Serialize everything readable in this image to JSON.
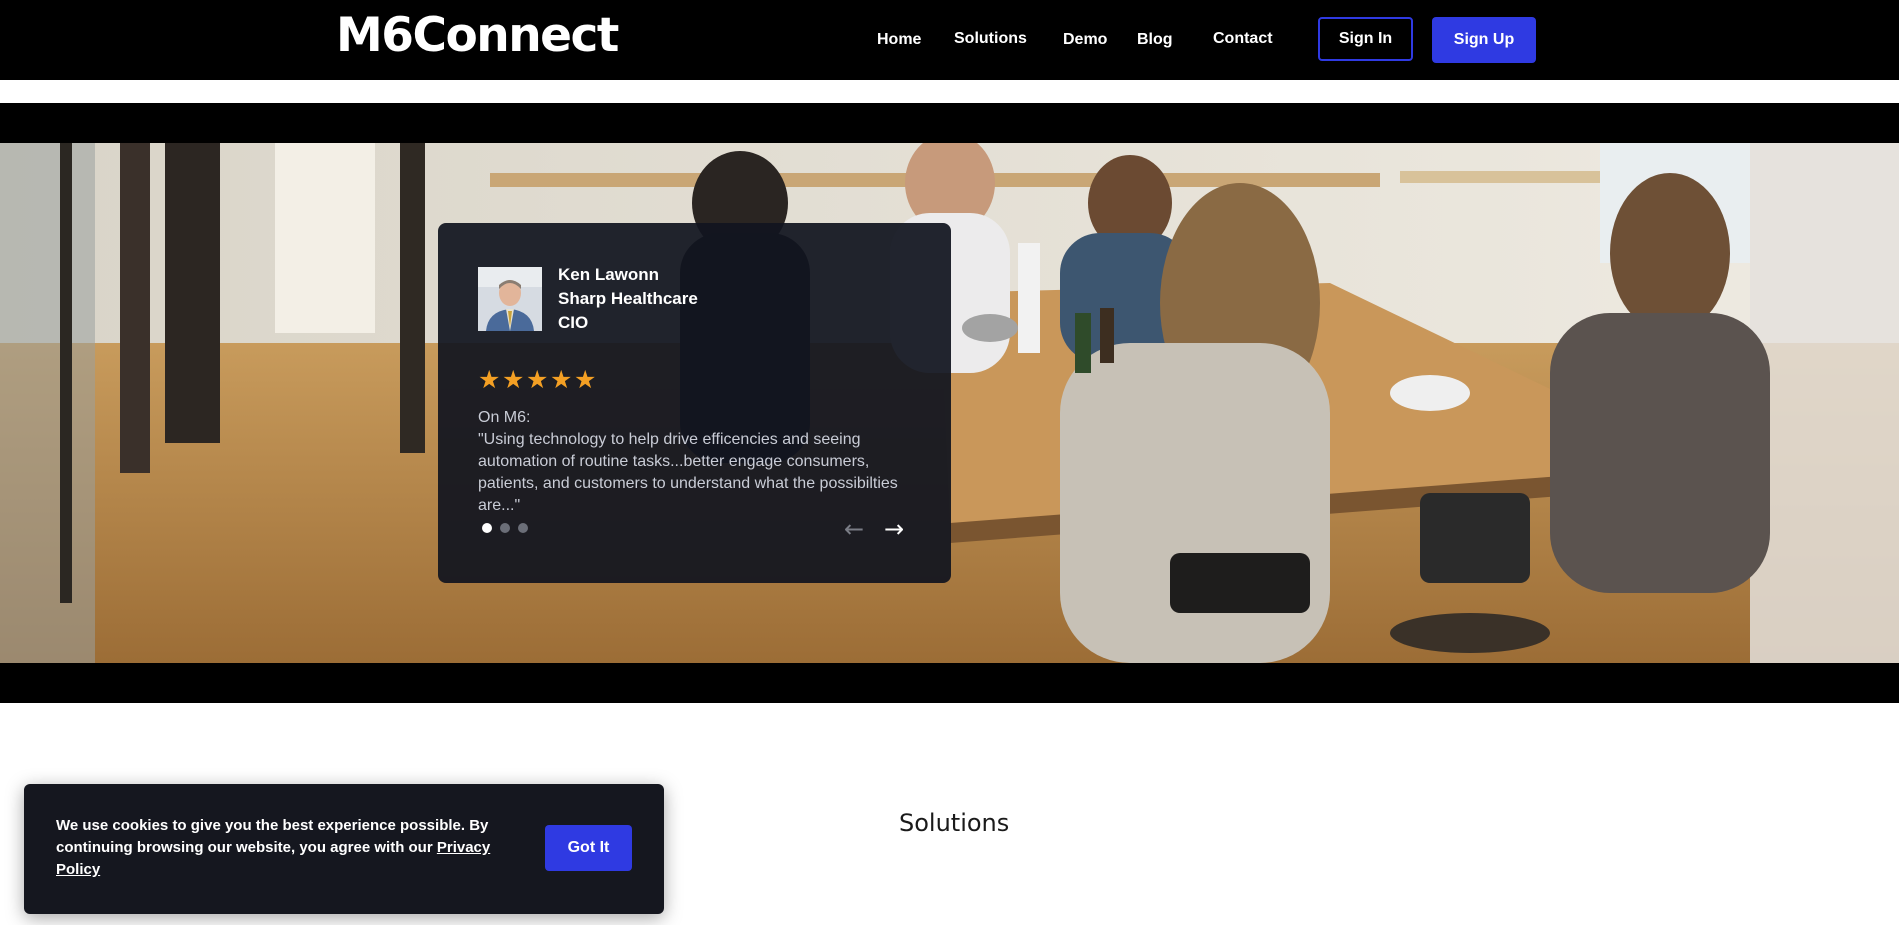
{
  "header": {
    "logo": "M6Connect",
    "nav": [
      {
        "label": "Home"
      },
      {
        "label": "Solutions"
      },
      {
        "label": "Demo"
      },
      {
        "label": "Blog"
      },
      {
        "label": "Contact"
      }
    ],
    "signin_label": "Sign In",
    "signup_label": "Sign Up",
    "accent_color": "#2f3ae2"
  },
  "testimonial": {
    "name": "Ken Lawonn",
    "company": "Sharp Healthcare",
    "title": "CIO",
    "rating": 5,
    "rating_max": 5,
    "star_color": "#f4a024",
    "quote_label": "On M6:",
    "quote": "\"Using technology to help drive efficencies and seeing automation of routine tasks...better engage consumers, patients, and customers to understand what the possibilties are...\"",
    "slide_count": 3,
    "active_slide": 1
  },
  "section": {
    "heading": "Solutions"
  },
  "cookie": {
    "text": "We use cookies to give you the best experience possible. By continuing browsing our website, you agree with our ",
    "link_label": "Privacy Policy",
    "button_label": "Got It"
  }
}
